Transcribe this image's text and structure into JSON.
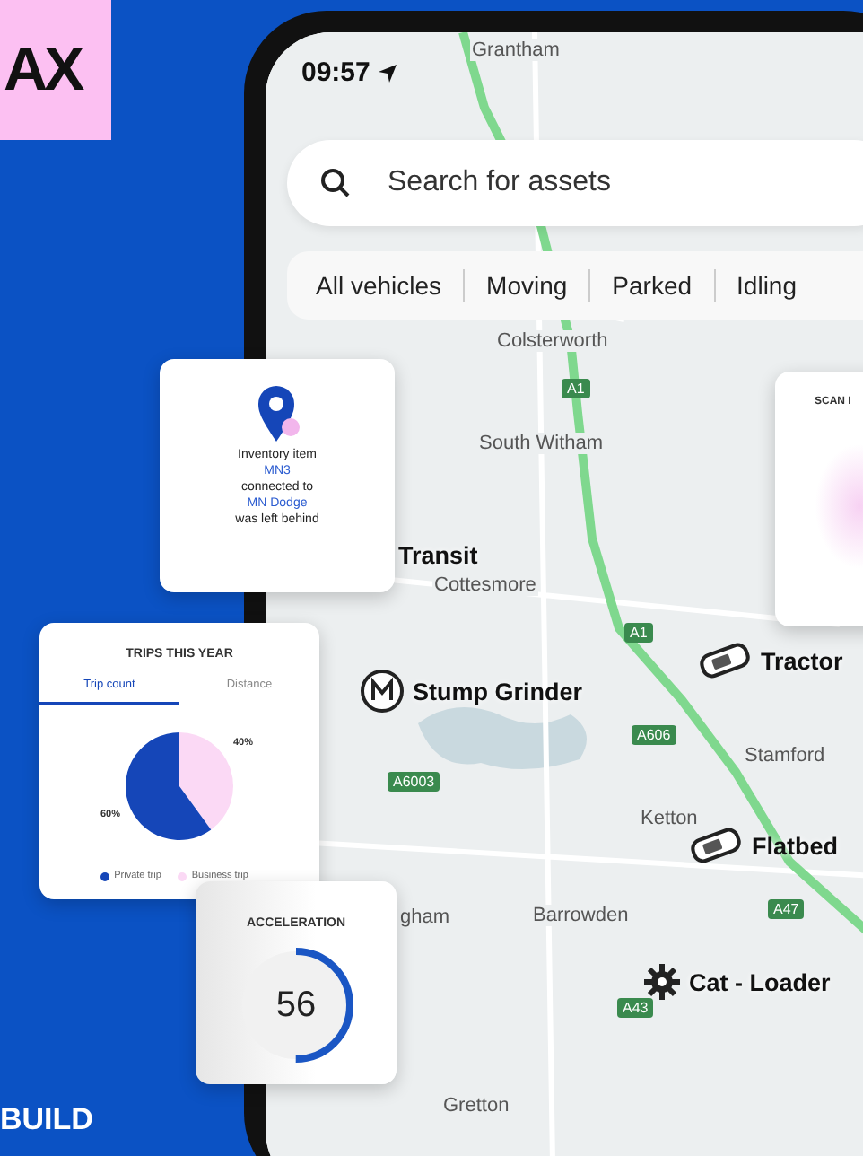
{
  "brand": {
    "logo_text": "AX"
  },
  "tagline": "BUILD",
  "phone": {
    "status_bar": {
      "time": "09:57"
    },
    "search": {
      "placeholder": "Search for assets"
    },
    "filters": [
      {
        "label": "All vehicles"
      },
      {
        "label": "Moving"
      },
      {
        "label": "Parked"
      },
      {
        "label": "Idling"
      }
    ],
    "map": {
      "places": [
        "Grantham",
        "Colsterworth",
        "South Witham",
        "Cottesmore",
        "Stamford",
        "Ketton",
        "Barrowden",
        "gham",
        "Gretton"
      ],
      "roads": [
        "A1",
        "A1",
        "A606",
        "A6003",
        "A47",
        "A43"
      ],
      "assets": [
        {
          "name": "Transit",
          "kind": "label"
        },
        {
          "name": "Stump Grinder",
          "kind": "machine"
        },
        {
          "name": "Tractor",
          "kind": "vehicle"
        },
        {
          "name": "Flatbed",
          "kind": "vehicle"
        },
        {
          "name": "Cat - Loader",
          "kind": "equipment"
        }
      ]
    }
  },
  "cards": {
    "alert": {
      "lines": [
        {
          "text": "Inventory item",
          "kind": "plain"
        },
        {
          "text": "MN3",
          "kind": "link"
        },
        {
          "text": "connected to",
          "kind": "plain"
        },
        {
          "text": "MN Dodge",
          "kind": "link"
        },
        {
          "text": "was left behind",
          "kind": "plain"
        }
      ]
    },
    "trips": {
      "title": "TRIPS THIS YEAR",
      "tabs": [
        {
          "label": "Trip count",
          "selected": true
        },
        {
          "label": "Distance",
          "selected": false
        }
      ],
      "chart_data": {
        "type": "pie",
        "categories": [
          "Private trip",
          "Business trip"
        ],
        "values": [
          60,
          40
        ],
        "colors": [
          "#1546b8",
          "#fbd9f5"
        ],
        "value_labels": [
          "60%",
          "40%"
        ]
      }
    },
    "acceleration": {
      "title": "ACCELERATION",
      "value": "56",
      "level": 0.5
    },
    "scan": {
      "title": "SCAN I"
    }
  }
}
